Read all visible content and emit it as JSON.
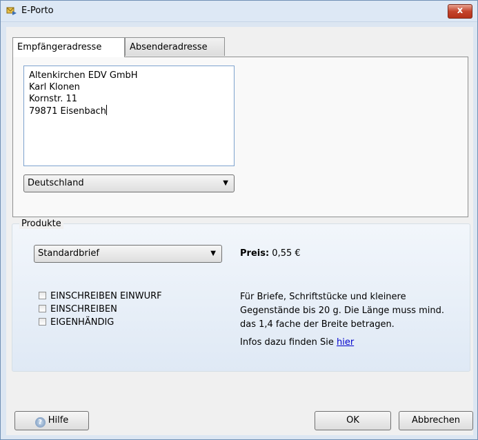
{
  "window": {
    "title": "E-Porto",
    "close_label": "x"
  },
  "tabs": [
    {
      "label": "Empfängeradresse",
      "active": true
    },
    {
      "label": "Absenderadresse",
      "active": false
    }
  ],
  "address": {
    "lines": [
      "Altenkirchen EDV GmbH",
      "Karl Klonen",
      "Kornstr. 11",
      "79871 Eisenbach"
    ],
    "text": "Altenkirchen EDV GmbH\nKarl Klonen\nKornstr. 11\n79871 Eisenbach"
  },
  "country": {
    "selected": "Deutschland"
  },
  "products": {
    "group_label": "Produkte",
    "selected": "Standardbrief",
    "price_label": "Preis:",
    "price_value": "0,55 €",
    "options": [
      {
        "label": "EINSCHREIBEN EINWURF",
        "checked": false
      },
      {
        "label": "EINSCHREIBEN",
        "checked": false
      },
      {
        "label": "EIGENHÄNDIG",
        "checked": false
      }
    ],
    "description": "Für Briefe, Schriftstücke und kleinere Gegenstände bis 20 g. Die Länge muss mind. das 1,4 fache der Breite betragen.",
    "info_text": "Infos dazu finden Sie ",
    "info_link": "hier"
  },
  "buttons": {
    "help": "Hilfe",
    "ok": "OK",
    "cancel": "Abbrechen"
  },
  "colors": {
    "window_frame": "#6f8fb5",
    "close_button": "#c4442c",
    "link": "#0000cc"
  },
  "icons": {
    "title": "envelope-arrow-icon",
    "help": "help-question-icon",
    "dropdown": "chevron-down-icon"
  }
}
